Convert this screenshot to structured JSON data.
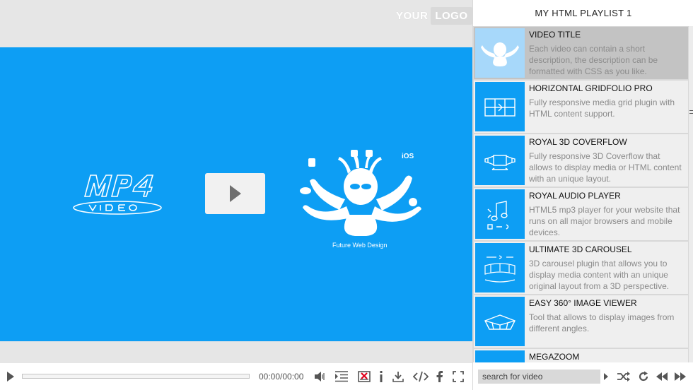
{
  "logo": {
    "part1": "YOUR",
    "part2": "LOGO"
  },
  "video": {
    "tagline": "Future Web Design"
  },
  "controls": {
    "time": "00:00/00:00"
  },
  "playlist": {
    "title": "MY HTML PLAYLIST 1",
    "items": [
      {
        "name": "VIDEO TITLE",
        "description": "Each video can contain a short description, the description can be formatted with CSS as you like."
      },
      {
        "name": "HORIZONTAL GRIDFOLIO PRO",
        "description": "Fully responsive media grid plugin with HTML content support."
      },
      {
        "name": "ROYAL 3D COVERFLOW",
        "description": "Fully responsive 3D Coverflow that allows to display media or HTML content with an unique layout."
      },
      {
        "name": "ROYAL AUDIO PLAYER",
        "description": "HTML5 mp3 player for your website that runs on all major browsers and mobile devices."
      },
      {
        "name": "ULTIMATE 3D CAROUSEL",
        "description": "3D carousel plugin that allows you to display media content with an unique original layout from a 3D perspective."
      },
      {
        "name": "EASY 360° IMAGE VIEWER",
        "description": "Tool that allows to display images from different angles."
      },
      {
        "name": "MEGAZOOM",
        "description": ""
      }
    ],
    "search_placeholder": "search for video"
  },
  "colors": {
    "video_bg": "#0d9ef4",
    "active_item": "#c3c3c3",
    "item_bg": "#efefef"
  }
}
